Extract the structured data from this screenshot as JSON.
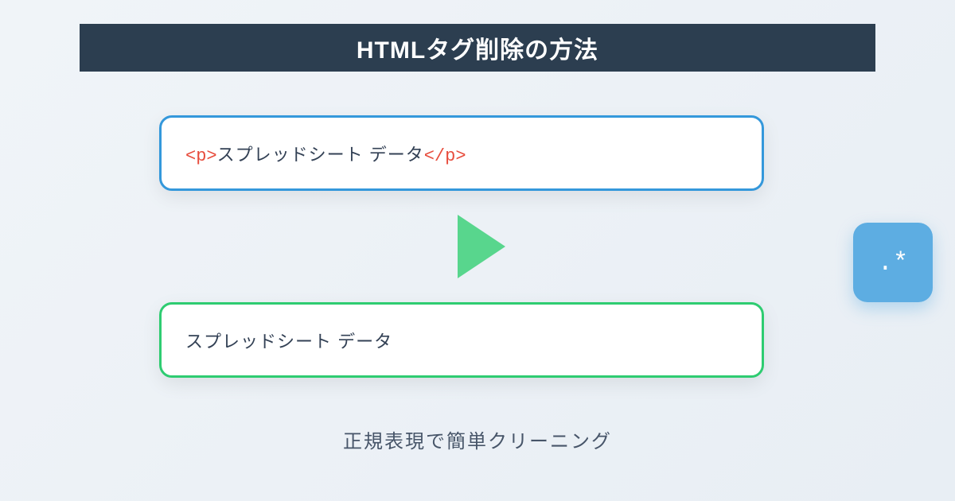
{
  "title": "HTMLタグ削除の方法",
  "subtitle": "正規表現で簡単クリーニング",
  "input": {
    "tag_open": "<p>",
    "text": "スプレッドシート データ",
    "tag_close": "</p>"
  },
  "output": {
    "text": "スプレッドシート データ"
  },
  "regex_badge": ".*",
  "colors": {
    "header_bg": "#2c3e50",
    "input_border": "#3498db",
    "output_border": "#2ecc71",
    "tag_color": "#e74c3c",
    "arrow_color": "#58d68d",
    "badge_bg": "#5dade2"
  }
}
